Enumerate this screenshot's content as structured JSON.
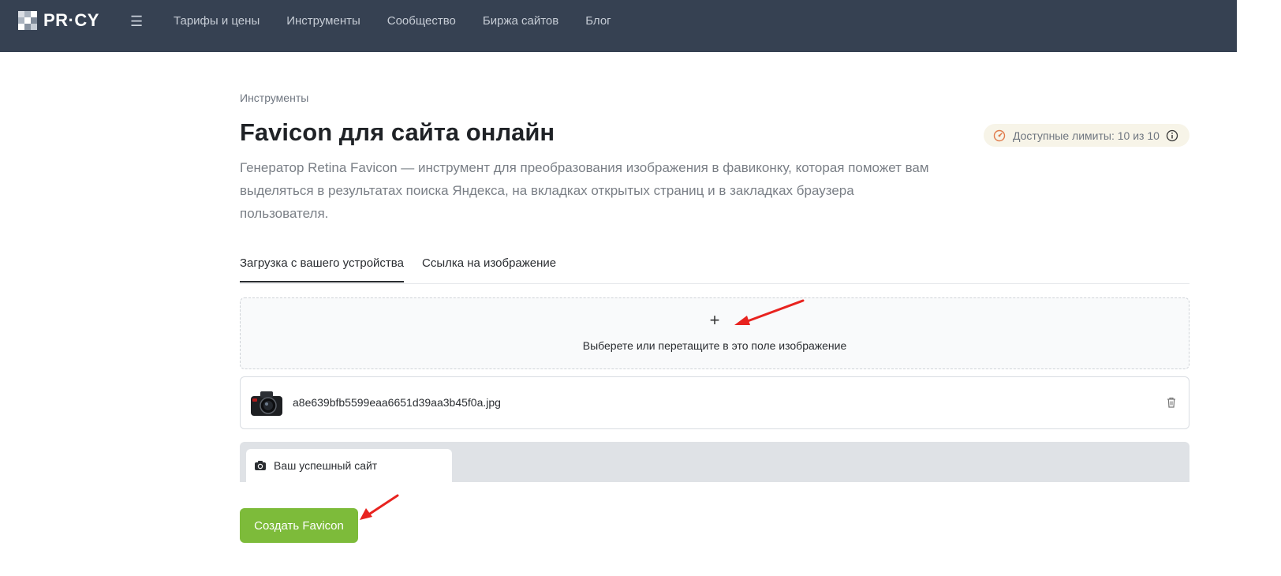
{
  "header": {
    "logo_text": "PR·CY",
    "menu_icon": "hamburger-icon",
    "nav": [
      {
        "label": "Тарифы и цены"
      },
      {
        "label": "Инструменты"
      },
      {
        "label": "Сообщество"
      },
      {
        "label": "Биржа сайтов"
      },
      {
        "label": "Блог"
      }
    ]
  },
  "page": {
    "breadcrumb": "Инструменты",
    "title": "Favicon для сайта онлайн",
    "description": "Генератор Retina Favicon — инструмент для преобразования изображения в фавиконку, которая поможет вам выделяться в результатах поиска Яндекса, на вкладках открытых страниц и в закладках браузера пользователя.",
    "limits": {
      "label": "Доступные лимиты: 10 из 10",
      "icon": "gauge-icon",
      "info_icon": "info-icon"
    }
  },
  "tabs": [
    {
      "label": "Загрузка с вашего устройства",
      "active": true
    },
    {
      "label": "Ссылка на изображение",
      "active": false
    }
  ],
  "upload": {
    "plus": "+",
    "hint": "Выберете или перетащите в это поле изображение"
  },
  "file": {
    "name": "a8e639bfb5599eaa6651d39aa3b45f0a.jpg",
    "thumb_icon": "camera-photo-thumbnail",
    "delete_icon": "trash-icon"
  },
  "preview": {
    "tab_title": "Ваш успешный сайт",
    "favicon_icon": "camera-icon"
  },
  "actions": {
    "create_label": "Создать Favicon"
  },
  "colors": {
    "header_bg": "#364152",
    "accent_green": "#7dbb3a",
    "annotation_red": "#e8231f"
  }
}
